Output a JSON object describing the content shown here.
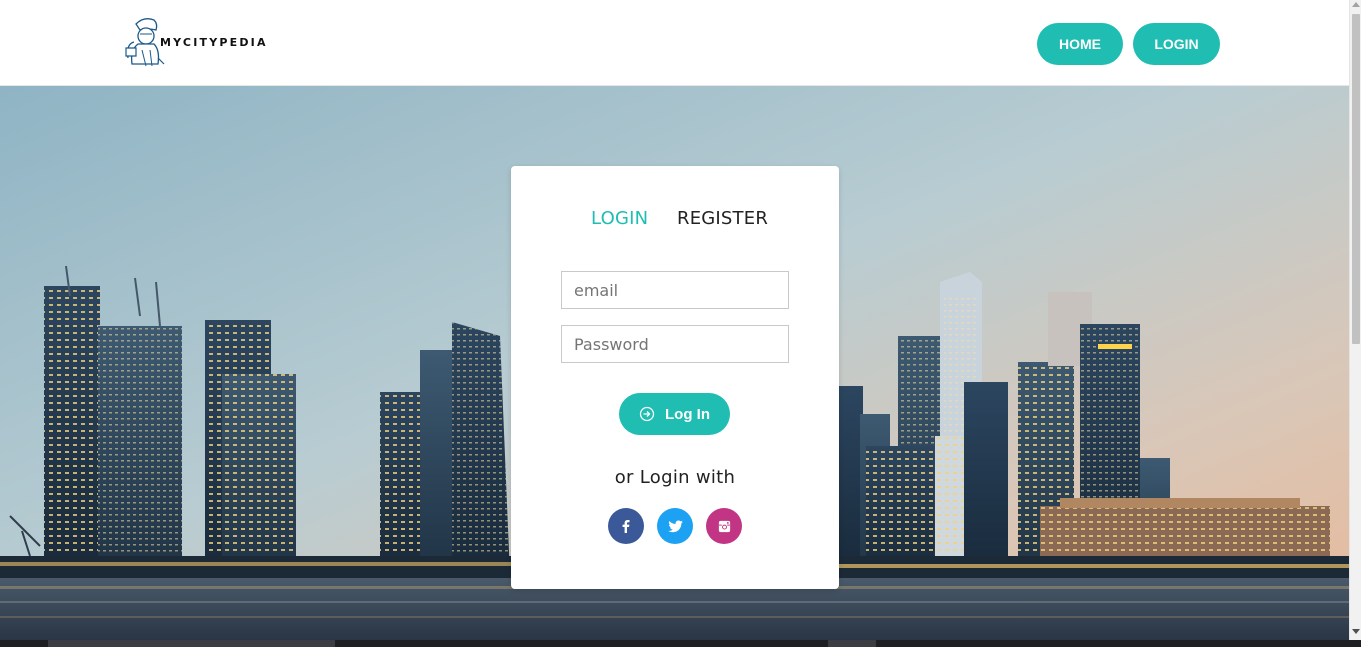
{
  "brand": {
    "name": "MYCITYPEDIA"
  },
  "nav": {
    "home_label": "HOME",
    "login_label": "LOGIN"
  },
  "card": {
    "tabs": {
      "login": "LOGIN",
      "register": "REGISTER"
    },
    "email": {
      "placeholder": "email",
      "value": ""
    },
    "password": {
      "placeholder": "Password",
      "value": ""
    },
    "submit_label": "Log In",
    "or_text": "or Login with",
    "social": [
      {
        "name": "facebook",
        "icon": "facebook-icon"
      },
      {
        "name": "twitter",
        "icon": "twitter-icon"
      },
      {
        "name": "instagram",
        "icon": "instagram-icon"
      }
    ]
  },
  "colors": {
    "accent": "#1fbdb2",
    "facebook": "#3b5998",
    "twitter": "#1da1f2",
    "instagram": "#c13584"
  }
}
